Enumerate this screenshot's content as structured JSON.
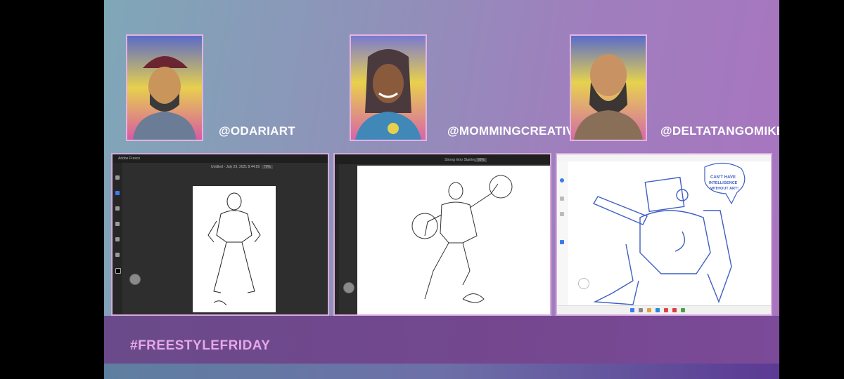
{
  "hashtag": "#FREESTYLEFRIDAY",
  "participants": [
    {
      "handle": "@ODARIART"
    },
    {
      "handle": "@MOMMINGCREATIVELY"
    },
    {
      "handle": "@DELTATANGOMIKE"
    }
  ],
  "screens": [
    {
      "app_title": "Adobe Fresco",
      "doc_title": "Untitled - July 29, 2021 8:44:59",
      "zoom": "70%"
    },
    {
      "doc_title": "Strong Intro Starting*",
      "zoom": "66%"
    },
    {
      "speech_bubble": "CAN'T HAVE INTELLIGENCE WITHOUT ART!"
    }
  ],
  "colors": {
    "handle": "#ffffff",
    "hashtag": "#e6a8e8",
    "frame_border": "#e3b3e4",
    "sketch_blue": "#3f5fc4"
  },
  "icons": [
    "pen-icon",
    "brush-icon",
    "eraser-icon",
    "select-icon",
    "undo-icon",
    "redo-icon"
  ]
}
